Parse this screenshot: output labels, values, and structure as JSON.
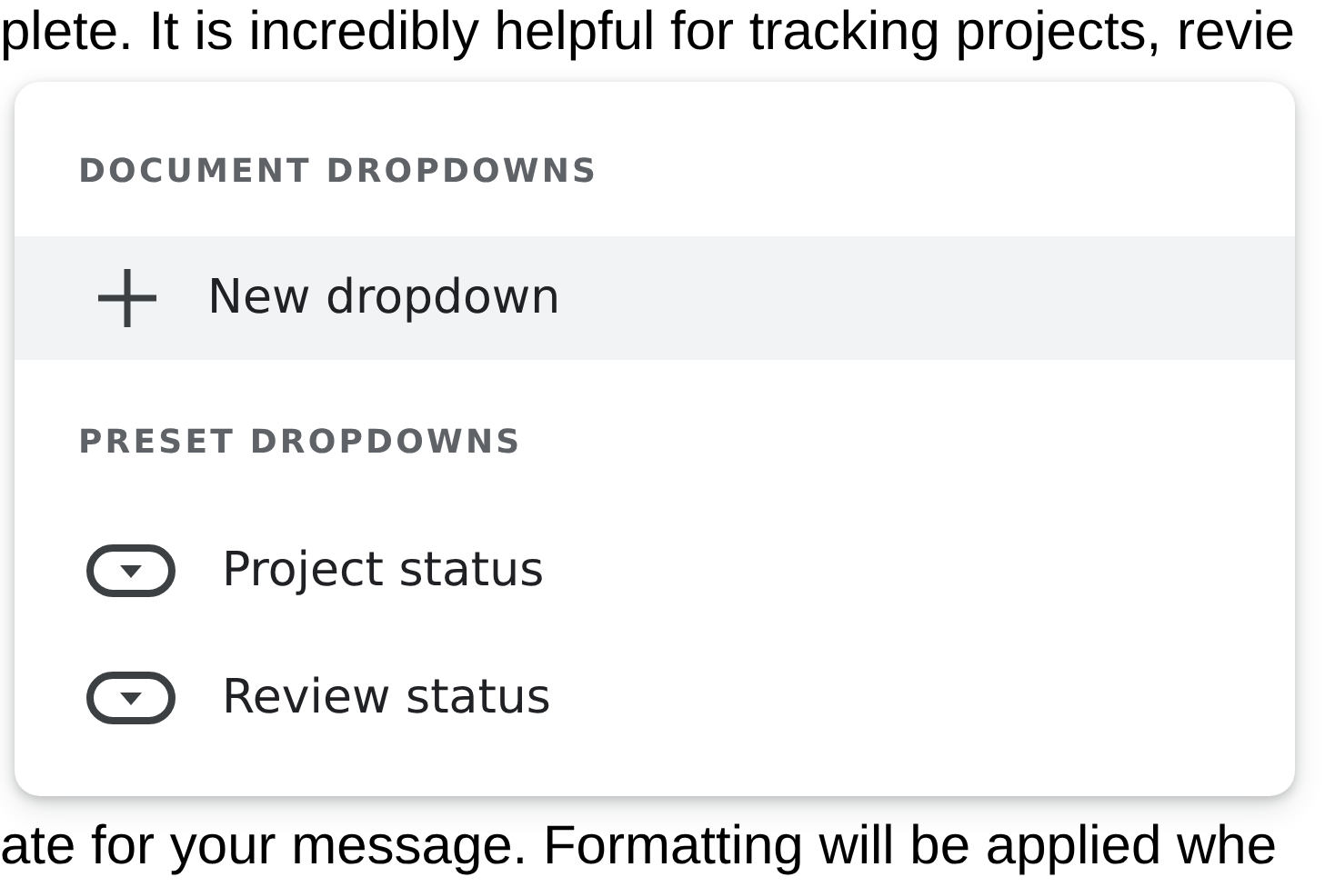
{
  "document": {
    "lines": [
      {
        "text": "plete. It is incredibly helpful for tracking projects, revie"
      },
      {
        "text": "ate for your message. Formatting will be applied whe"
      }
    ]
  },
  "menu": {
    "sections": [
      {
        "heading": "DOCUMENT DROPDOWNS",
        "items": [
          {
            "kind": "add",
            "label": "New dropdown",
            "selected": true
          }
        ]
      },
      {
        "heading": "PRESET DROPDOWNS",
        "items": [
          {
            "kind": "preset",
            "label": "Project status",
            "selected": false
          },
          {
            "kind": "preset",
            "label": "Review status",
            "selected": false
          }
        ]
      }
    ]
  }
}
